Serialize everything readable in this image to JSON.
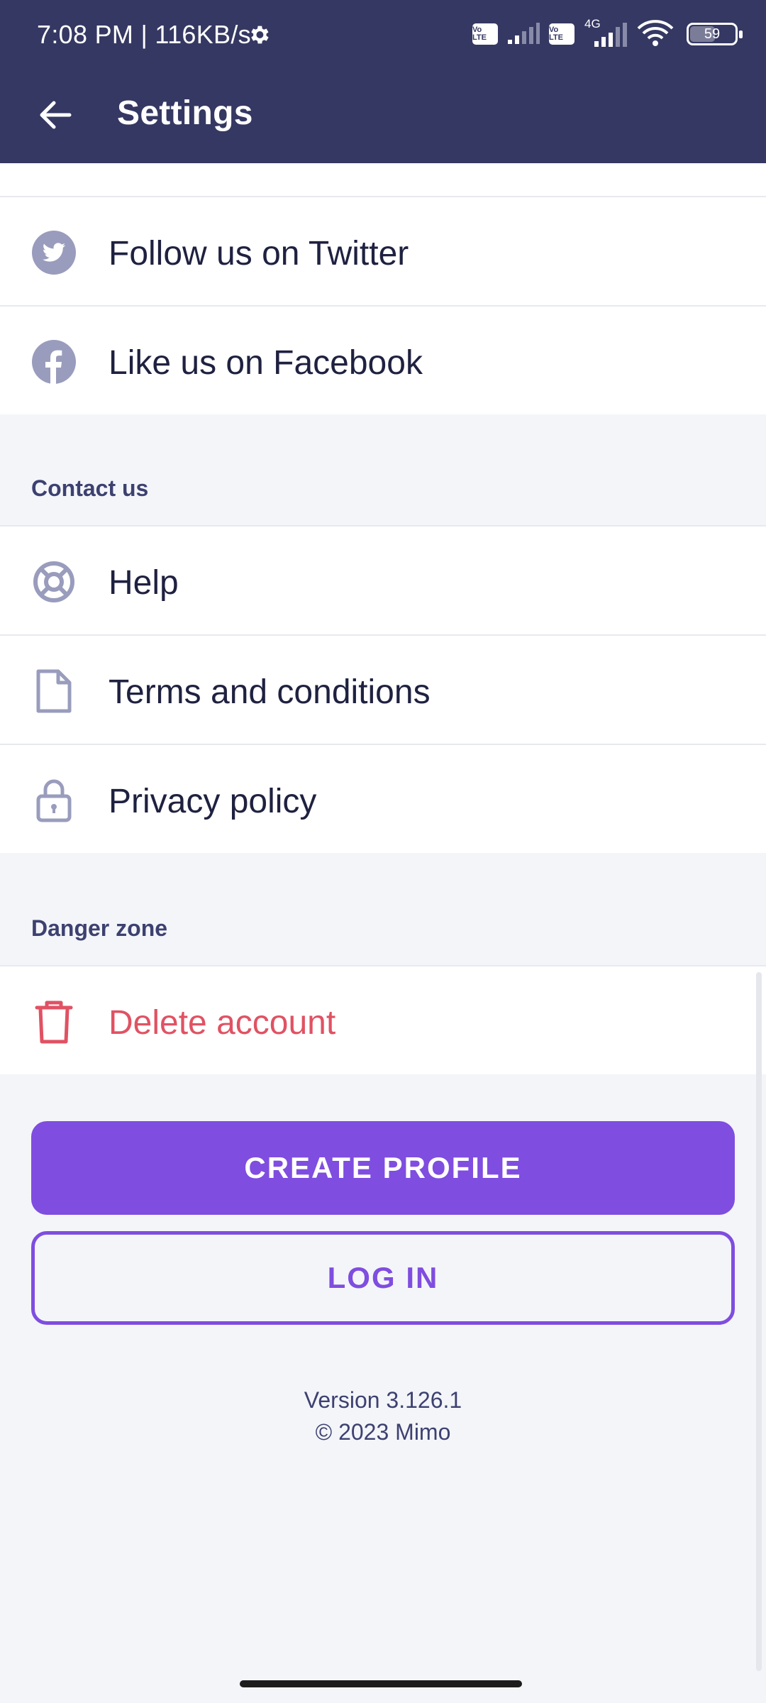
{
  "status_bar": {
    "time_speed": "7:08 PM | 116KB/s",
    "volte_1": "Vo LTE",
    "volte_2": "Vo LTE",
    "network": "4G",
    "battery": "59",
    "battery_level_percent": 59
  },
  "app_bar": {
    "title": "Settings",
    "back_icon": "arrow-left-icon"
  },
  "social": {
    "items": [
      {
        "label": "Follow us on Twitter",
        "icon": "twitter-icon"
      },
      {
        "label": "Like us on Facebook",
        "icon": "facebook-icon"
      }
    ]
  },
  "contact": {
    "header": "Contact us",
    "items": [
      {
        "label": "Help",
        "icon": "lifebuoy-icon"
      },
      {
        "label": "Terms and conditions",
        "icon": "document-icon"
      },
      {
        "label": "Privacy policy",
        "icon": "lock-icon"
      }
    ]
  },
  "danger": {
    "header": "Danger zone",
    "items": [
      {
        "label": "Delete account",
        "icon": "trash-icon"
      }
    ]
  },
  "actions": {
    "create_profile": "CREATE PROFILE",
    "log_in": "LOG IN"
  },
  "footer": {
    "version": "Version 3.126.1",
    "copyright": "© 2023 Mimo"
  },
  "colors": {
    "app_bar": "#353862",
    "background": "#f4f5f9",
    "icon": "#9a9cbd",
    "danger": "#e05263",
    "primary": "#7f4de0"
  }
}
